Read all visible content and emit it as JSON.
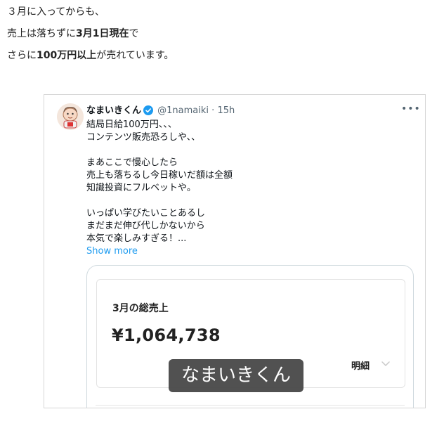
{
  "intro": {
    "line1": "３月に入ってからも、",
    "line2_pre": "売上は落ちずに",
    "line2_bold": "3月1日現在",
    "line2_post": "で",
    "line3_pre": "さらに",
    "line3_bold": "100万円以上",
    "line3_post": "が売れています。"
  },
  "tweet": {
    "display_name": "なまいきくん",
    "handle": "@1namaiki",
    "separator": "·",
    "time": "15h",
    "more_icon": "•••",
    "lines": [
      "結局日給100万円、、、",
      "コンテンツ販売恐ろしや、、",
      "",
      "まあここで慢心したら",
      "売上も落ちるし今日稼いだ額は全額",
      "知識投資にフルベットや。",
      "",
      "いっぱい学びたいことあるし",
      "まだまだ伸び代しかないから",
      "本気で楽しみすぎる！..."
    ],
    "show_more": "Show more"
  },
  "card": {
    "title": "3月の総売上",
    "amount": "¥1,064,738",
    "detail_label": "明細"
  },
  "watermark": "なまいきくん",
  "colors": {
    "link": "#1d9bf0",
    "verified": "#1d9bf0",
    "muted": "#536471"
  }
}
